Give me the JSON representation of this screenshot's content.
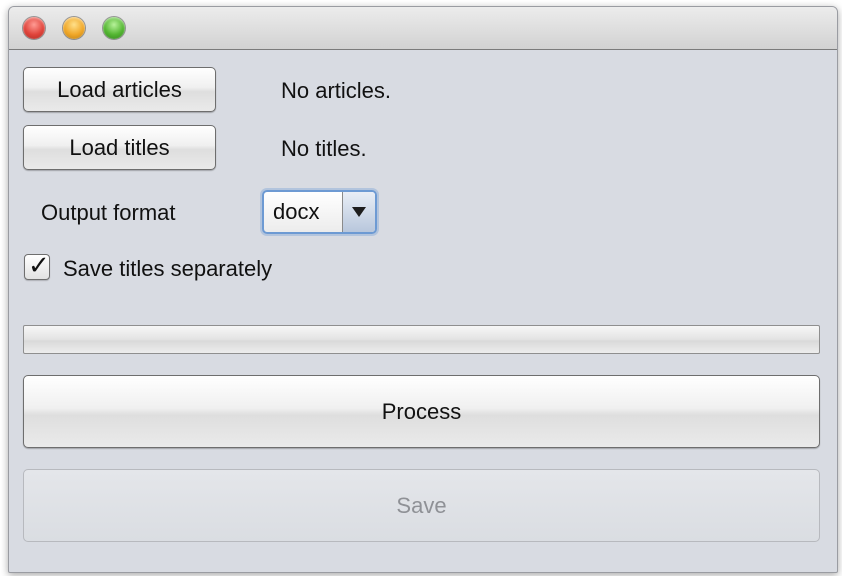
{
  "window": {
    "controls": [
      "close-icon",
      "minimize-icon",
      "zoom-icon"
    ]
  },
  "articles": {
    "button_label": "Load articles",
    "status": "No articles."
  },
  "titles": {
    "button_label": "Load titles",
    "status": "No titles."
  },
  "output": {
    "label": "Output format",
    "selected": "docx"
  },
  "save_separately": {
    "label": "Save titles separately",
    "checked": true,
    "check_glyph": "✓"
  },
  "progress": {
    "value": 0
  },
  "actions": {
    "process_label": "Process",
    "save_label": "Save",
    "save_enabled": false
  },
  "colors": {
    "window_bg": "#d8dbe2",
    "focus_ring": "#6d9ad3",
    "close": "#e0443b",
    "minimize": "#f0a728",
    "zoom": "#54b632"
  }
}
